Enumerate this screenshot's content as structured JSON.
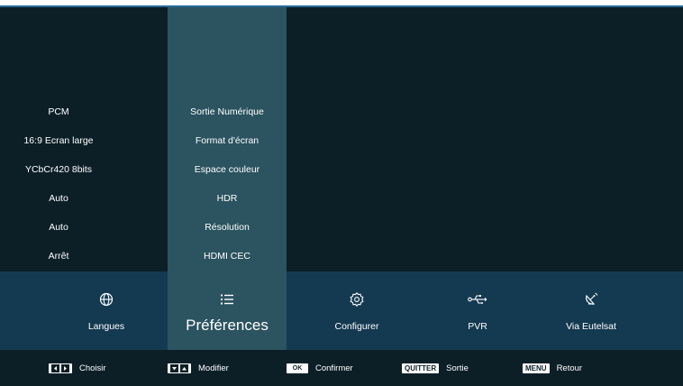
{
  "settings": [
    {
      "label": "Sortie Numérique",
      "value": "PCM"
    },
    {
      "label": "Format d'écran",
      "value": "16:9 Ecran large"
    },
    {
      "label": "Espace couleur",
      "value": "YCbCr420 8bits"
    },
    {
      "label": "HDR",
      "value": "Auto"
    },
    {
      "label": "Résolution",
      "value": "Auto"
    },
    {
      "label": "HDMI CEC",
      "value": "Arrêt"
    }
  ],
  "menu": [
    {
      "label": "Langues",
      "icon": "globe-icon"
    },
    {
      "label": "Préférences",
      "icon": "list-icon",
      "selected": true
    },
    {
      "label": "Configurer",
      "icon": "gear-icon"
    },
    {
      "label": "PVR",
      "icon": "usb-icon"
    },
    {
      "label": "Via Eutelsat",
      "icon": "satellite-dish-icon"
    }
  ],
  "footer": {
    "choose": "Choisir",
    "modify": "Modifier",
    "ok_key": "OK",
    "confirm": "Confirmer",
    "quit_key": "QUITTER",
    "exit": "Sortie",
    "menu_key": "MENU",
    "back": "Retour"
  },
  "colors": {
    "background": "#0c1f27",
    "selection": "#2b5360",
    "menubar": "#143a51",
    "accent_line": "#2a6a9a"
  }
}
